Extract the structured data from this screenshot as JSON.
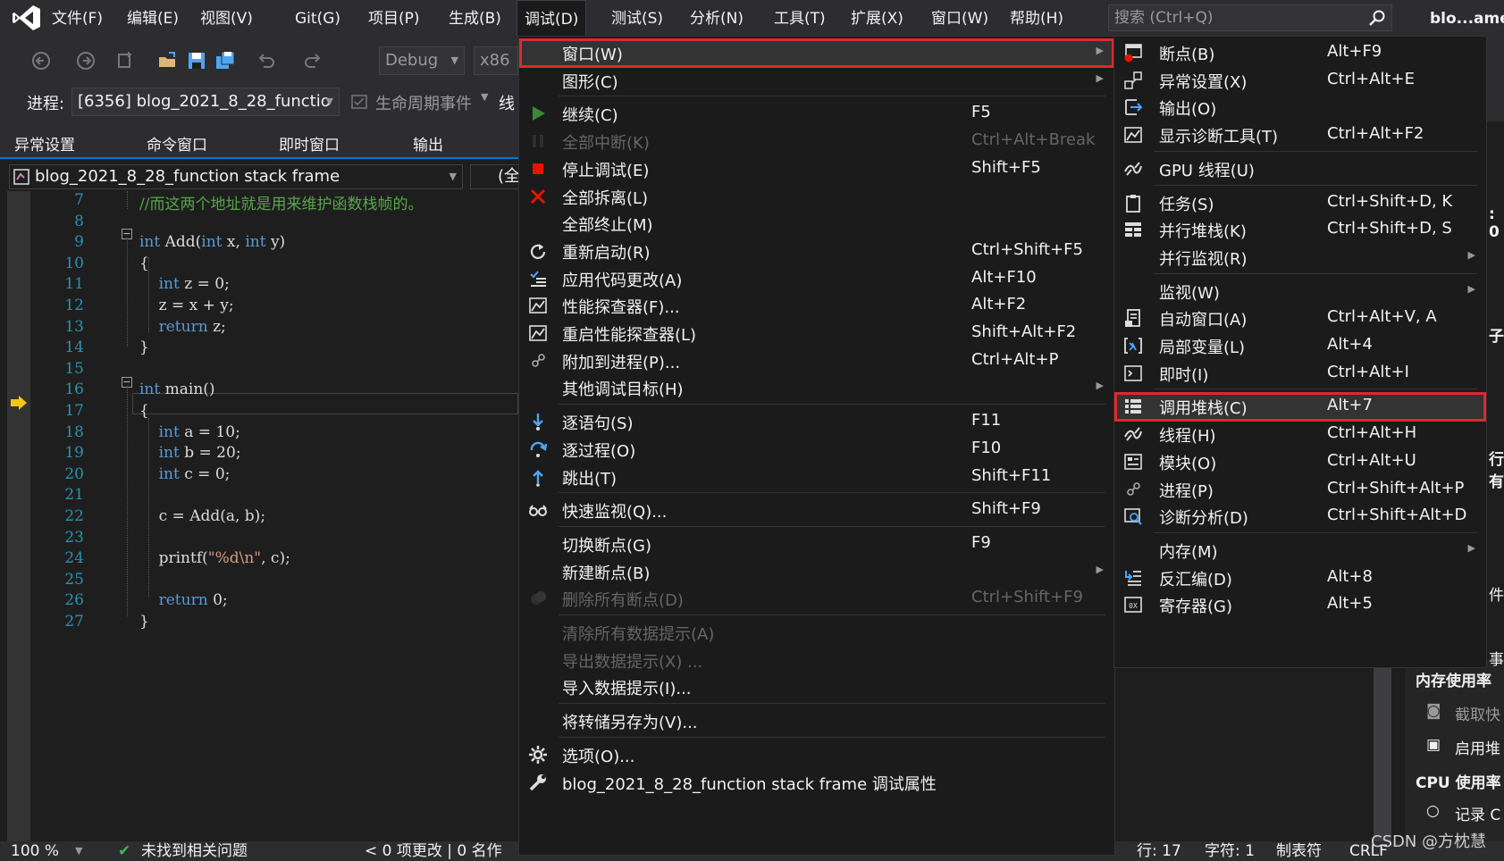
{
  "colors": {
    "accent": "#007acc",
    "highlight_border": "#e0282e",
    "menu_bg": "#1b1b1c",
    "chrome_bg": "#2d2d30"
  },
  "menubar": {
    "items": [
      "文件(F)",
      "编辑(E)",
      "视图(V)",
      "Git(G)",
      "项目(P)",
      "生成(B)",
      "调试(D)",
      "测试(S)",
      "分析(N)",
      "工具(T)",
      "扩展(X)",
      "窗口(W)",
      "帮助(H)"
    ],
    "active": "调试(D)",
    "search_placeholder": "搜索 (Ctrl+Q)",
    "window_title": "blo...ame"
  },
  "toolbar": {
    "config": "Debug",
    "platform": "x86",
    "process_label": "进程:",
    "process_value": "[6356] blog_2021_8_28_functio",
    "lifecycle_label": "生命周期事件",
    "thread_label": "线"
  },
  "tool_tabs": [
    "异常设置",
    "命令窗口",
    "即时窗口",
    "输出"
  ],
  "editor": {
    "nav_scope": "blog_2021_8_28_function stack frame",
    "nav_scope2": "(全局",
    "current_line": 17,
    "lines": [
      {
        "n": "7",
        "html": "<span class=\"cm\">//而这两个地址就是用来维护函数栈帧的。</span>"
      },
      {
        "n": "8",
        "html": ""
      },
      {
        "n": "9",
        "html": "<span class=\"kw\">int</span> Add(<span class=\"kw\">int</span> x, <span class=\"kw\">int</span> y)"
      },
      {
        "n": "10",
        "html": "{"
      },
      {
        "n": "11",
        "html": "    <span class=\"kw\">int</span> z = 0;"
      },
      {
        "n": "12",
        "html": "    z = x + y;"
      },
      {
        "n": "13",
        "html": "    <span class=\"kw\">return</span> z;"
      },
      {
        "n": "14",
        "html": "}"
      },
      {
        "n": "15",
        "html": ""
      },
      {
        "n": "16",
        "html": "<span class=\"kw\">int</span> main()"
      },
      {
        "n": "17",
        "html": "{"
      },
      {
        "n": "18",
        "html": "    <span class=\"kw\">int</span> a = 10;"
      },
      {
        "n": "19",
        "html": "    <span class=\"kw\">int</span> b = 20;"
      },
      {
        "n": "20",
        "html": "    <span class=\"kw\">int</span> c = 0;"
      },
      {
        "n": "21",
        "html": ""
      },
      {
        "n": "22",
        "html": "    c = Add(a, b);"
      },
      {
        "n": "23",
        "html": ""
      },
      {
        "n": "24",
        "html": "    printf(<span class=\"str\">\"%d\\n\"</span>, c);"
      },
      {
        "n": "25",
        "html": ""
      },
      {
        "n": "26",
        "html": "    <span class=\"kw\">return</span> 0;"
      },
      {
        "n": "27",
        "html": "}"
      }
    ]
  },
  "debug_menu": {
    "items": [
      {
        "label": "窗口(W)",
        "shortcut": "",
        "icon": "",
        "submenu": true,
        "highlighted": true
      },
      {
        "label": "图形(C)",
        "shortcut": "",
        "icon": "",
        "submenu": true
      },
      {
        "sep": true
      },
      {
        "label": "继续(C)",
        "shortcut": "F5",
        "icon": "continue-icon"
      },
      {
        "label": "全部中断(K)",
        "shortcut": "Ctrl+Alt+Break",
        "icon": "pause-icon",
        "disabled": true
      },
      {
        "label": "停止调试(E)",
        "shortcut": "Shift+F5",
        "icon": "stop-icon"
      },
      {
        "label": "全部拆离(L)",
        "shortcut": "",
        "icon": "detach-icon"
      },
      {
        "label": "全部终止(M)",
        "shortcut": "",
        "icon": ""
      },
      {
        "label": "重新启动(R)",
        "shortcut": "Ctrl+Shift+F5",
        "icon": "restart-icon"
      },
      {
        "label": "应用代码更改(A)",
        "shortcut": "Alt+F10",
        "icon": "apply-changes-icon"
      },
      {
        "label": "性能探查器(F)...",
        "shortcut": "Alt+F2",
        "icon": "profiler-icon"
      },
      {
        "label": "重启性能探查器(L)",
        "shortcut": "Shift+Alt+F2",
        "icon": "profiler-icon"
      },
      {
        "label": "附加到进程(P)...",
        "shortcut": "Ctrl+Alt+P",
        "icon": "attach-icon"
      },
      {
        "label": "其他调试目标(H)",
        "shortcut": "",
        "icon": "",
        "submenu": true
      },
      {
        "sep": true
      },
      {
        "label": "逐语句(S)",
        "shortcut": "F11",
        "icon": "step-into-icon"
      },
      {
        "label": "逐过程(O)",
        "shortcut": "F10",
        "icon": "step-over-icon"
      },
      {
        "label": "跳出(T)",
        "shortcut": "Shift+F11",
        "icon": "step-out-icon"
      },
      {
        "sep": true
      },
      {
        "label": "快速监视(Q)...",
        "shortcut": "Shift+F9",
        "icon": "quickwatch-icon"
      },
      {
        "sep": true
      },
      {
        "label": "切换断点(G)",
        "shortcut": "F9",
        "icon": ""
      },
      {
        "label": "新建断点(B)",
        "shortcut": "",
        "icon": "",
        "submenu": true
      },
      {
        "label": "删除所有断点(D)",
        "shortcut": "Ctrl+Shift+F9",
        "icon": "delete-breakpoints-icon",
        "disabled": true
      },
      {
        "sep": true
      },
      {
        "label": "清除所有数据提示(A)",
        "shortcut": "",
        "icon": "",
        "disabled": true
      },
      {
        "label": "导出数据提示(X) ...",
        "shortcut": "",
        "icon": "",
        "disabled": true
      },
      {
        "label": "导入数据提示(I)...",
        "shortcut": "",
        "icon": ""
      },
      {
        "sep": true
      },
      {
        "label": "将转储另存为(V)...",
        "shortcut": "",
        "icon": ""
      },
      {
        "sep": true
      },
      {
        "label": "选项(O)...",
        "shortcut": "",
        "icon": "gear-icon"
      },
      {
        "label": "blog_2021_8_28_function stack frame 调试属性",
        "shortcut": "",
        "icon": "wrench-icon"
      }
    ]
  },
  "window_submenu": {
    "items": [
      {
        "label": "断点(B)",
        "shortcut": "Alt+F9",
        "icon": "breakpoints-icon"
      },
      {
        "label": "异常设置(X)",
        "shortcut": "Ctrl+Alt+E",
        "icon": "exception-icon"
      },
      {
        "label": "输出(O)",
        "shortcut": "",
        "icon": "output-icon"
      },
      {
        "label": "显示诊断工具(T)",
        "shortcut": "Ctrl+Alt+F2",
        "icon": "diagnostics-icon"
      },
      {
        "sep": true
      },
      {
        "label": "GPU 线程(U)",
        "shortcut": "",
        "icon": "gpu-threads-icon"
      },
      {
        "sep": true
      },
      {
        "label": "任务(S)",
        "shortcut": "Ctrl+Shift+D, K",
        "icon": "tasks-icon"
      },
      {
        "label": "并行堆栈(K)",
        "shortcut": "Ctrl+Shift+D, S",
        "icon": "parallel-stacks-icon"
      },
      {
        "label": "并行监视(R)",
        "shortcut": "",
        "icon": "",
        "submenu": true
      },
      {
        "sep": true
      },
      {
        "label": "监视(W)",
        "shortcut": "",
        "icon": "",
        "submenu": true
      },
      {
        "label": "自动窗口(A)",
        "shortcut": "Ctrl+Alt+V, A",
        "icon": "autos-icon"
      },
      {
        "label": "局部变量(L)",
        "shortcut": "Alt+4",
        "icon": "locals-icon"
      },
      {
        "label": "即时(I)",
        "shortcut": "Ctrl+Alt+I",
        "icon": "immediate-icon"
      },
      {
        "sep": true
      },
      {
        "label": "调用堆栈(C)",
        "shortcut": "Alt+7",
        "icon": "call-stack-icon",
        "highlighted": true
      },
      {
        "label": "线程(H)",
        "shortcut": "Ctrl+Alt+H",
        "icon": "threads-icon"
      },
      {
        "label": "模块(O)",
        "shortcut": "Ctrl+Alt+U",
        "icon": "modules-icon"
      },
      {
        "label": "进程(P)",
        "shortcut": "Ctrl+Shift+Alt+P",
        "icon": "processes-icon"
      },
      {
        "label": "诊断分析(D)",
        "shortcut": "Ctrl+Shift+Alt+D",
        "icon": "diagnostic-analysis-icon"
      },
      {
        "sep": true
      },
      {
        "label": "内存(M)",
        "shortcut": "",
        "icon": "",
        "submenu": true
      },
      {
        "label": "反汇编(D)",
        "shortcut": "Alt+8",
        "icon": "disassembly-icon"
      },
      {
        "label": "寄存器(G)",
        "shortcut": "Alt+5",
        "icon": "registers-icon"
      }
    ]
  },
  "right_panel": {
    "memory_usage": "内存使用率",
    "snapshot": "截取快",
    "enable_heap": "启用堆",
    "cpu_usage": "CPU 使用率",
    "record": "记录 C",
    "edge_snippets": [
      ": 0",
      "子",
      "行有",
      "件",
      "事"
    ]
  },
  "statusbar": {
    "zoom": "100 %",
    "issues": "未找到相关问题",
    "changes": "< 0  项更改 | 0  名作",
    "row": "行: 17",
    "col": "字符: 1",
    "tab": "制表符",
    "eol": "CRLF",
    "watermark": "CSDN @方枕慧"
  }
}
